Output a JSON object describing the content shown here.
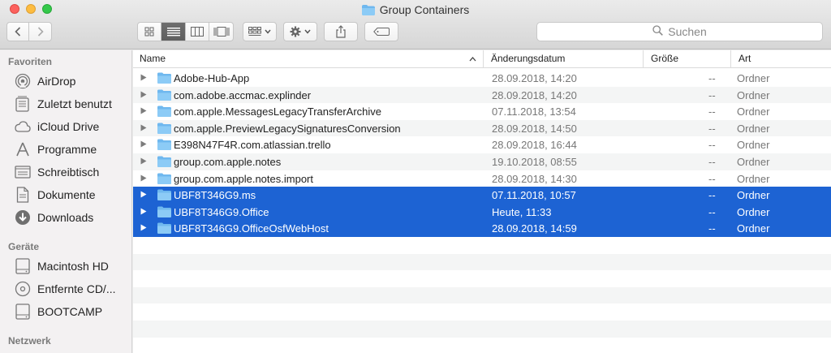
{
  "window": {
    "title": "Group Containers",
    "search_placeholder": "Suchen"
  },
  "sidebar": {
    "sections": [
      {
        "label": "Favoriten",
        "items": [
          {
            "label": "AirDrop",
            "icon": "airdrop-icon"
          },
          {
            "label": "Zuletzt benutzt",
            "icon": "recents-icon"
          },
          {
            "label": "iCloud Drive",
            "icon": "cloud-icon"
          },
          {
            "label": "Programme",
            "icon": "applications-icon"
          },
          {
            "label": "Schreibtisch",
            "icon": "desktop-icon"
          },
          {
            "label": "Dokumente",
            "icon": "documents-icon"
          },
          {
            "label": "Downloads",
            "icon": "downloads-icon"
          }
        ]
      },
      {
        "label": "Geräte",
        "items": [
          {
            "label": "Macintosh HD",
            "icon": "disk-icon"
          },
          {
            "label": "Entfernte CD/...",
            "icon": "optical-disc-icon"
          },
          {
            "label": "BOOTCAMP",
            "icon": "disk-icon"
          }
        ]
      },
      {
        "label": "Netzwerk",
        "items": []
      }
    ]
  },
  "columns": {
    "name": "Name",
    "date": "Änderungsdatum",
    "size": "Größe",
    "kind": "Art"
  },
  "files": [
    {
      "name": "Adobe-Hub-App",
      "date": "28.09.2018, 14:20",
      "size": "--",
      "kind": "Ordner",
      "selected": false
    },
    {
      "name": "com.adobe.accmac.explinder",
      "date": "28.09.2018, 14:20",
      "size": "--",
      "kind": "Ordner",
      "selected": false
    },
    {
      "name": "com.apple.MessagesLegacyTransferArchive",
      "date": "07.11.2018, 13:54",
      "size": "--",
      "kind": "Ordner",
      "selected": false
    },
    {
      "name": "com.apple.PreviewLegacySignaturesConversion",
      "date": "28.09.2018, 14:50",
      "size": "--",
      "kind": "Ordner",
      "selected": false
    },
    {
      "name": "E398N47F4R.com.atlassian.trello",
      "date": "28.09.2018, 16:44",
      "size": "--",
      "kind": "Ordner",
      "selected": false
    },
    {
      "name": "group.com.apple.notes",
      "date": "19.10.2018, 08:55",
      "size": "--",
      "kind": "Ordner",
      "selected": false
    },
    {
      "name": "group.com.apple.notes.import",
      "date": "28.09.2018, 14:30",
      "size": "--",
      "kind": "Ordner",
      "selected": false
    },
    {
      "name": "UBF8T346G9.ms",
      "date": "07.11.2018, 10:57",
      "size": "--",
      "kind": "Ordner",
      "selected": true
    },
    {
      "name": "UBF8T346G9.Office",
      "date": "Heute, 11:33",
      "size": "--",
      "kind": "Ordner",
      "selected": true
    },
    {
      "name": "UBF8T346G9.OfficeOsfWebHost",
      "date": "28.09.2018, 14:59",
      "size": "--",
      "kind": "Ordner",
      "selected": true
    }
  ],
  "colors": {
    "selection": "#1d63d3",
    "folder": "#6fb8ef"
  }
}
